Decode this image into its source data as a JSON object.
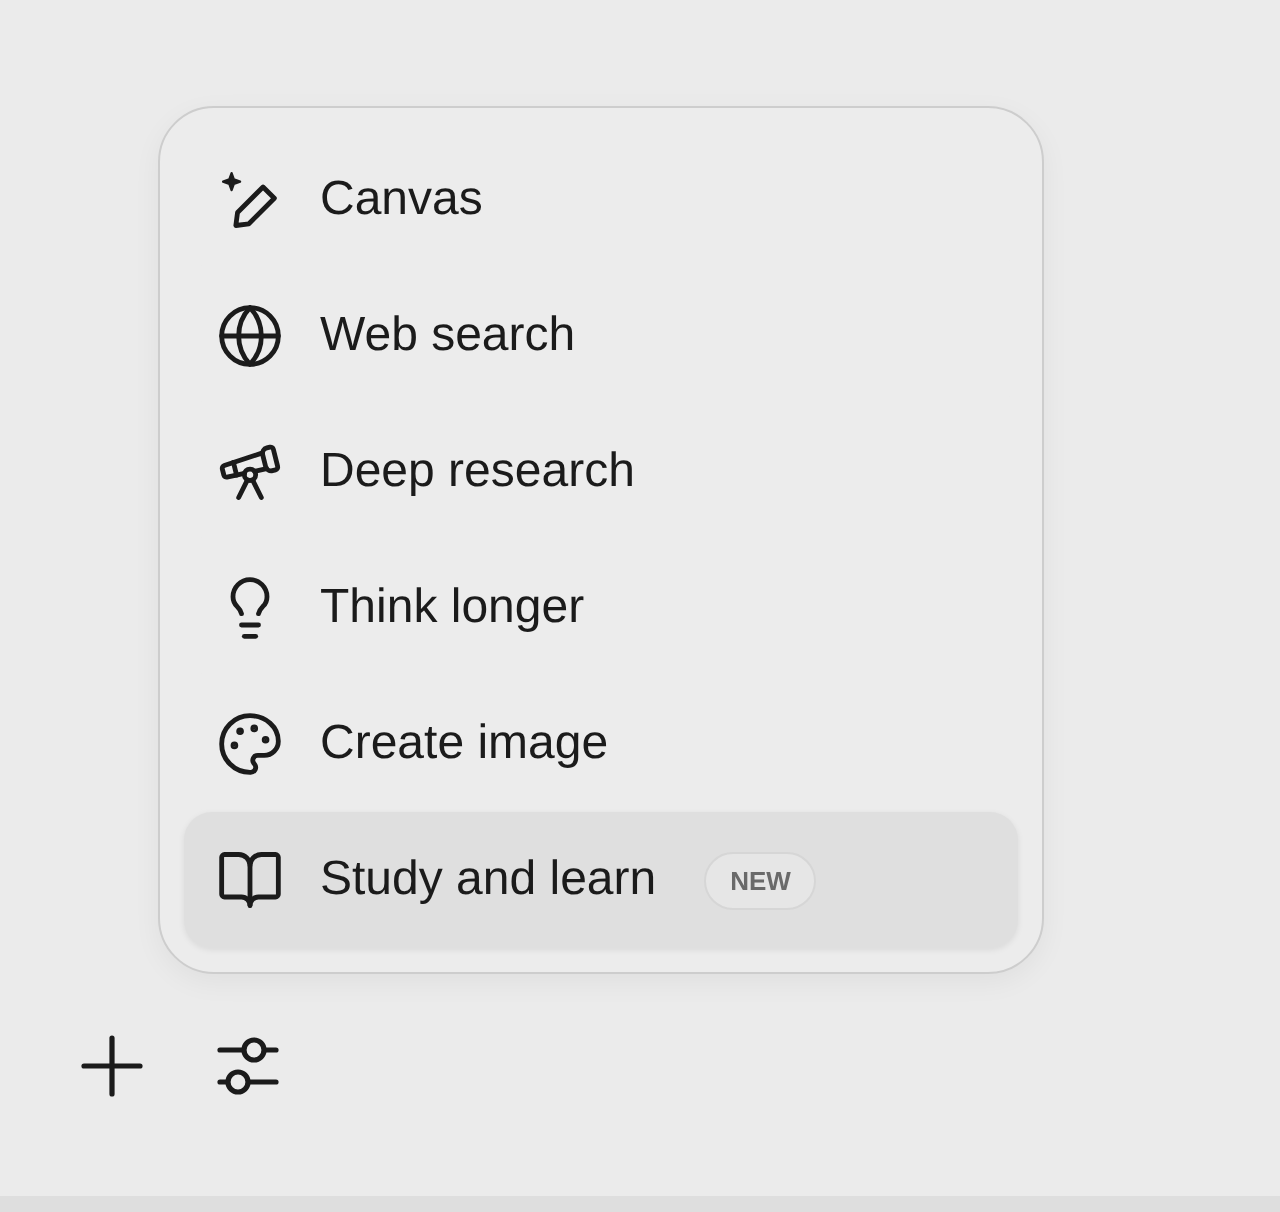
{
  "menu": {
    "items": [
      {
        "kind": "canvas",
        "label": "Canvas",
        "selected": false
      },
      {
        "kind": "web",
        "label": "Web search",
        "selected": false
      },
      {
        "kind": "research",
        "label": "Deep research",
        "selected": false
      },
      {
        "kind": "think",
        "label": "Think longer",
        "selected": false
      },
      {
        "kind": "image",
        "label": "Create image",
        "selected": false
      },
      {
        "kind": "study",
        "label": "Study and learn",
        "badge": "NEW",
        "selected": true
      }
    ]
  }
}
